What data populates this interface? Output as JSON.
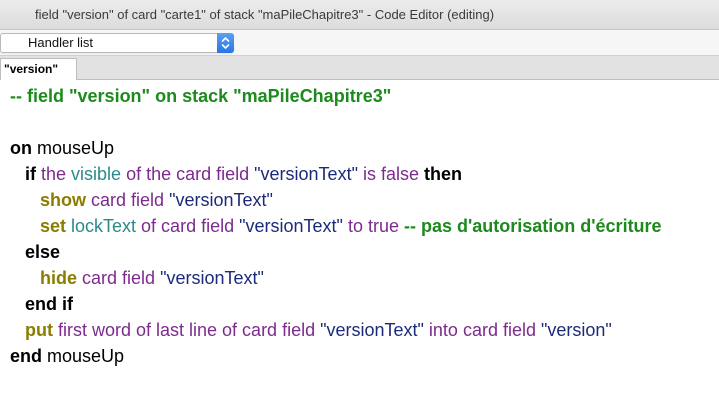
{
  "window": {
    "title": "field \"version\" of card \"carte1\" of stack \"maPileChapitre3\" - Code Editor (editing)"
  },
  "handler_list": {
    "selected": "Handler list"
  },
  "tabs": [
    {
      "label": "\"version\""
    }
  ],
  "code": {
    "l1_comment": "-- field \"version\" on stack \"maPileChapitre3\"",
    "l3_on": "on",
    "l3_handler": " mouseUp",
    "l4_if": "if",
    "l4_the": " the",
    "l4_visible": " visible",
    "l4_ofthe": " of the card field",
    "l4_str": " \"versionText\"",
    "l4_isfalse": " is false",
    "l4_then": " then",
    "l5_show": "show",
    "l5_cardfield": " card field",
    "l5_str": " \"versionText\"",
    "l6_set": "set",
    "l6_locktext": " lockText",
    "l6_of": " of card field",
    "l6_str": " \"versionText\"",
    "l6_totrue": " to true",
    "l6_comment": " -- pas d'autorisation d'écriture",
    "l7_else": "else",
    "l8_hide": "hide",
    "l8_cardfield": " card field",
    "l8_str": " \"versionText\"",
    "l9_endif": "end if",
    "l10_put": "put",
    "l10_expr": " first word of last line of card field",
    "l10_str": " \"versionText\"",
    "l10_into": " into card field",
    "l10_str2": " \"version\"",
    "l11_end": "end",
    "l11_handler": " mouseUp"
  },
  "colors": {
    "keyword": "#000000",
    "property": "#7d2a8e",
    "property_alt": "#2b8a8a",
    "string": "#1d2a7a",
    "command": "#8b7d00",
    "comment": "#1d8a1d",
    "stepper_accent": "#2a74e6"
  }
}
